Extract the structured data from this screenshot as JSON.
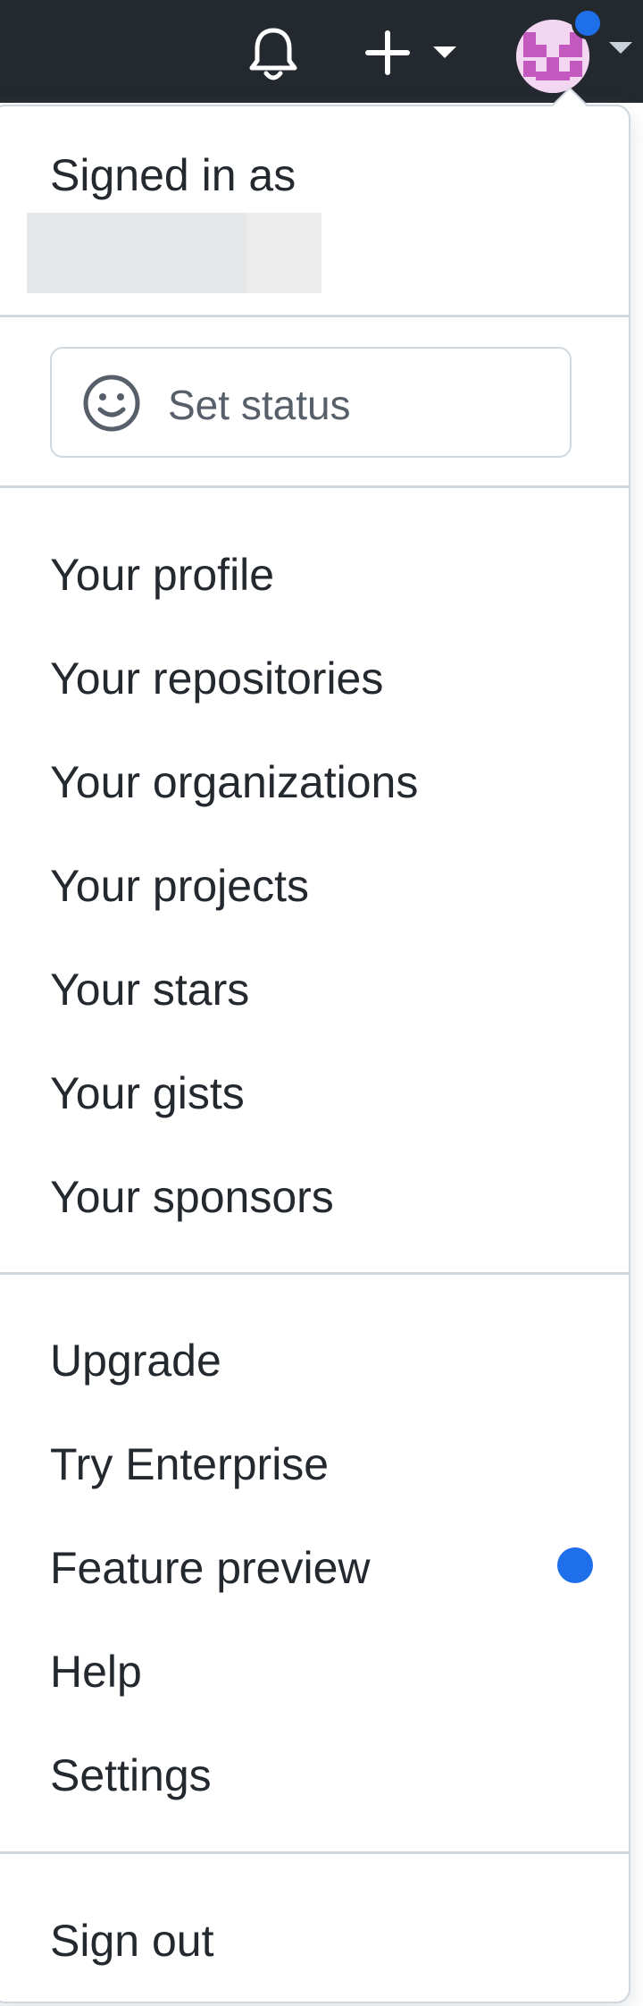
{
  "header": {
    "notifications_icon": "bell-icon",
    "create_icon": "plus-icon",
    "avatar_icon": "avatar-identicon",
    "colors": {
      "bar": "#24292f",
      "accent": "#1f6feb"
    }
  },
  "menu": {
    "signed_in_label": "Signed in as",
    "set_status_label": "Set status",
    "profile_items": [
      "Your profile",
      "Your repositories",
      "Your organizations",
      "Your projects",
      "Your stars",
      "Your gists",
      "Your sponsors"
    ],
    "other_items": [
      "Upgrade",
      "Try Enterprise",
      "Feature preview",
      "Help",
      "Settings"
    ],
    "sign_out_label": "Sign out"
  }
}
